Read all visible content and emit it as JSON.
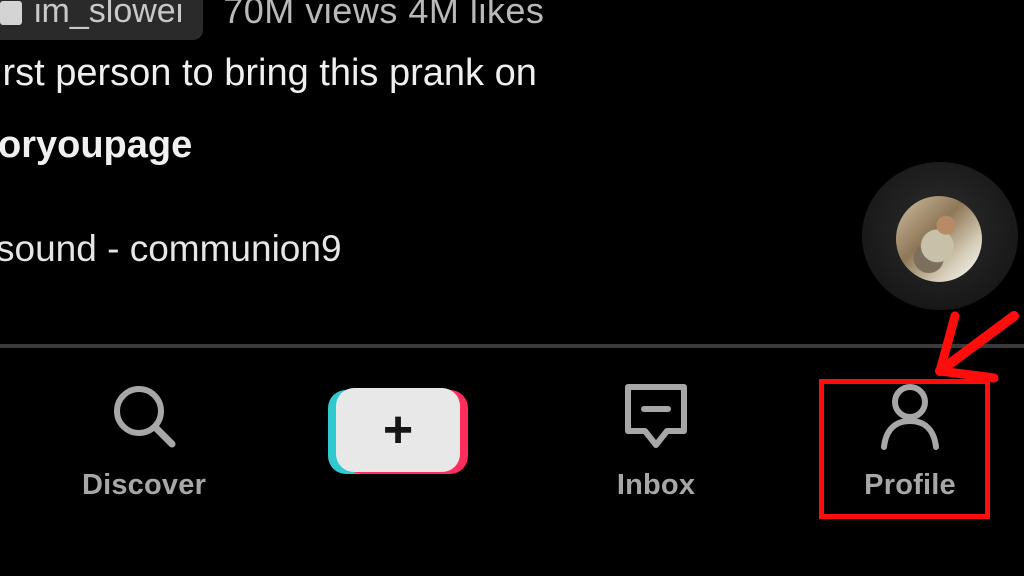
{
  "post": {
    "author_tag": "im_slowei",
    "stats": "70M views 4M likes",
    "caption": "irst person to bring this prank on",
    "hashtag": "oryoupage",
    "sound": "sound - communion9"
  },
  "nav": {
    "discover_label": "Discover",
    "create_symbol": "+",
    "inbox_label": "Inbox",
    "profile_label": "Profile"
  },
  "annotation": {
    "highlight_color": "#ff0d0d"
  },
  "icons": {
    "author_tag_icon": "user-tag-icon",
    "music_disc_icon": "music-disc-icon",
    "discover_icon": "search-icon",
    "create_icon": "plus-icon",
    "inbox_icon": "message-icon",
    "profile_icon": "profile-icon",
    "annotation_arrow": "arrow-icon"
  }
}
